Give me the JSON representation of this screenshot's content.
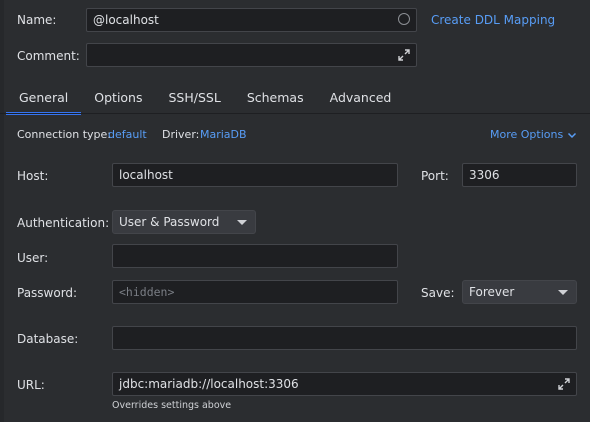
{
  "header": {
    "name_label": "Name:",
    "name_value": "@localhost",
    "create_ddl_link": "Create DDL Mapping",
    "comment_label": "Comment:",
    "comment_value": ""
  },
  "tabs": [
    {
      "label": "General",
      "active": true
    },
    {
      "label": "Options",
      "active": false
    },
    {
      "label": "SSH/SSL",
      "active": false
    },
    {
      "label": "Schemas",
      "active": false
    },
    {
      "label": "Advanced",
      "active": false
    }
  ],
  "info": {
    "connection_type_label": "Connection type:",
    "connection_type_value": "default",
    "driver_label": "Driver:",
    "driver_value": "MariaDB",
    "more_options": "More Options"
  },
  "form": {
    "host_label": "Host:",
    "host_value": "localhost",
    "port_label": "Port:",
    "port_value": "3306",
    "auth_label": "Authentication:",
    "auth_value": "User & Password",
    "user_label": "User:",
    "user_value": "",
    "password_label": "Password:",
    "password_placeholder": "<hidden>",
    "save_label": "Save:",
    "save_value": "Forever",
    "database_label": "Database:",
    "database_value": "",
    "url_label": "URL:",
    "url_value": "jdbc:mariadb://localhost:3306",
    "url_hint": "Overrides settings above"
  },
  "colors": {
    "background": "#2b2d30",
    "field_bg": "#1e1f22",
    "link": "#589df6",
    "tab_accent": "#3574f0"
  },
  "icons": [
    "radio-circle-icon",
    "expand-icon",
    "chevron-down-icon",
    "dropdown-caret-icon"
  ]
}
